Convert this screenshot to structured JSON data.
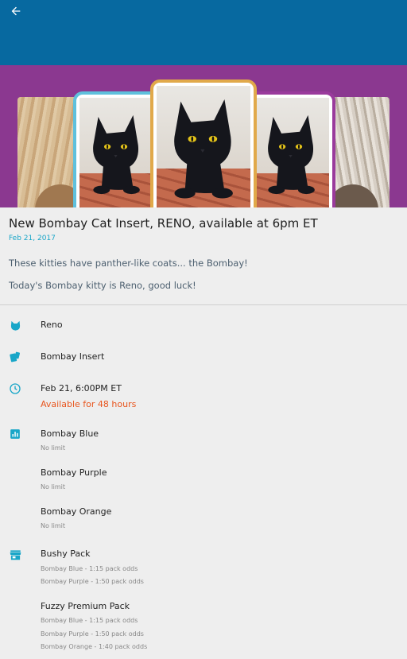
{
  "colors": {
    "appbar": "#0769a0",
    "hero_background": "#8b3890",
    "accent": "#19a6c8",
    "availability": "#e8561f"
  },
  "header": {
    "back_icon": "arrow-left-icon"
  },
  "hero": {
    "image": "bombay-cat-cards-and-packs"
  },
  "post": {
    "title": "New Bombay Cat Insert, RENO, available at 6pm ET",
    "date": "Feb 21, 2017",
    "paragraphs": [
      "These kitties have panther-like coats... the Bombay!",
      "Today's Bombay kitty is Reno, good luck!"
    ]
  },
  "details": {
    "cat": {
      "icon": "cat-face-icon",
      "name": "Reno"
    },
    "insert": {
      "icon": "cards-icon",
      "name": "Bombay Insert"
    },
    "availability": {
      "icon": "clock-icon",
      "time": "Feb 21, 6:00PM ET",
      "duration": "Available for 48 hours"
    },
    "parallels_icon": "bar-chart-icon",
    "parallels": [
      {
        "name": "Bombay Blue",
        "limit": "No limit"
      },
      {
        "name": "Bombay Purple",
        "limit": "No limit"
      },
      {
        "name": "Bombay Orange",
        "limit": "No limit"
      }
    ],
    "packs_icon": "store-icon",
    "packs": [
      {
        "name": "Bushy Pack",
        "odds": [
          "Bombay Blue - 1:15 pack odds",
          "Bombay Purple - 1:50 pack odds"
        ]
      },
      {
        "name": "Fuzzy Premium Pack",
        "odds": [
          "Bombay Blue - 1:15 pack odds",
          "Bombay Purple - 1:50 pack odds",
          "Bombay Orange - 1:40 pack odds"
        ]
      }
    ]
  }
}
